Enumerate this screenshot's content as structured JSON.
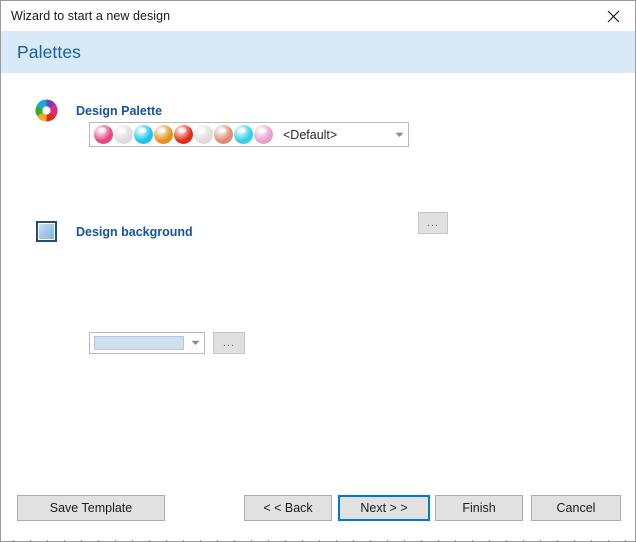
{
  "window": {
    "title": "Wizard to start a new design",
    "close_icon": "close-icon",
    "header_title": "Palettes"
  },
  "sections": {
    "palette": {
      "icon": "color-wheel-icon",
      "label": "Design Palette",
      "combo": {
        "value": "<Default>",
        "arrow_icon": "chevron-down-icon",
        "swatches": [
          {
            "name": "swatch-pink",
            "color": "#e4477f"
          },
          {
            "name": "swatch-silver",
            "color": "#dcdcdc"
          },
          {
            "name": "swatch-cyan",
            "color": "#19c6e8"
          },
          {
            "name": "swatch-orange",
            "color": "#e8921a"
          },
          {
            "name": "swatch-red",
            "color": "#e02a18"
          },
          {
            "name": "swatch-gray",
            "color": "#dedede"
          },
          {
            "name": "swatch-salmon",
            "color": "#e08b72"
          },
          {
            "name": "swatch-turquoise",
            "color": "#2fd0ea"
          },
          {
            "name": "swatch-rose",
            "color": "#eca0cd"
          }
        ]
      },
      "browse_label": "..."
    },
    "background": {
      "icon": "background-square-icon",
      "label": "Design background",
      "combo": {
        "swatch_color": "#cfe0ef",
        "arrow_icon": "chevron-down-icon"
      },
      "browse_label": "..."
    }
  },
  "footer": {
    "buttons": [
      {
        "name": "save-template-button",
        "label": "Save Template"
      },
      {
        "name": "back-button",
        "label": "< < Back"
      },
      {
        "name": "next-button",
        "label": "Next > >"
      },
      {
        "name": "finish-button",
        "label": "Finish"
      },
      {
        "name": "cancel-button",
        "label": "Cancel"
      }
    ]
  },
  "colors": {
    "header_band": "#d8e9f8",
    "header_text": "#16609e",
    "section_label": "#15539e",
    "focus_border": "#0078d7"
  }
}
